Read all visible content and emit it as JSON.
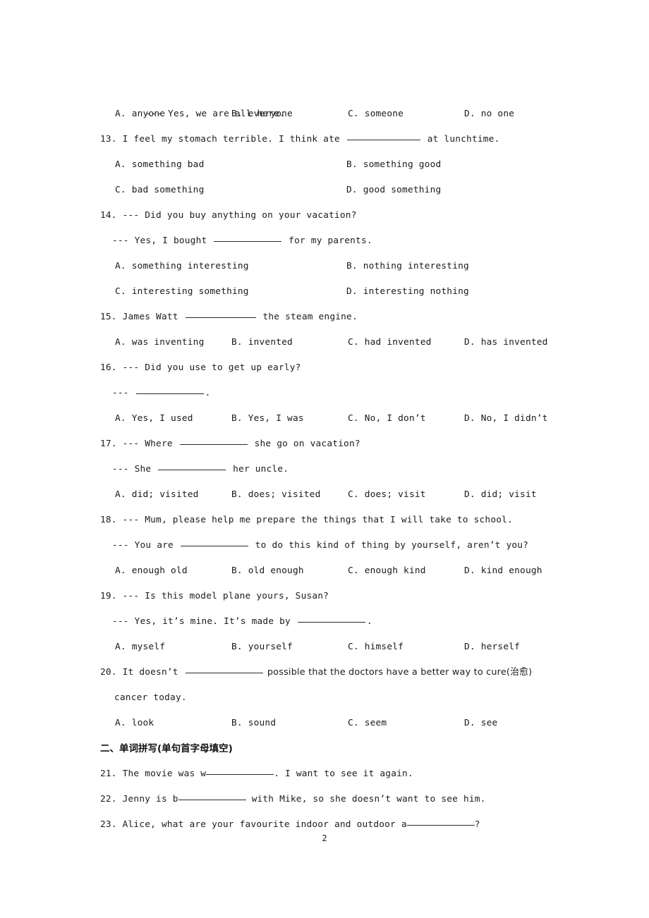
{
  "page": {
    "page_number": "2",
    "blank_mark": "______________"
  },
  "top_fragment": {
    "dialog_answer": "--- Yes, we are all here.",
    "options": [
      {
        "label": "A.",
        "text": "anyone"
      },
      {
        "label": "B.",
        "text": "everyone"
      },
      {
        "label": "C.",
        "text": "someone"
      },
      {
        "label": "D.",
        "text": "no one"
      }
    ]
  },
  "questions": [
    {
      "number": "13.",
      "stem_before": "I feel my stomach terrible. I think ate ",
      "stem_after": " at lunchtime.",
      "layout": "two-column",
      "options": [
        {
          "label": "A.",
          "text": "something bad"
        },
        {
          "label": "B.",
          "text": "something good"
        },
        {
          "label": "C.",
          "text": "bad something"
        },
        {
          "label": "D.",
          "text": "good something"
        }
      ]
    },
    {
      "number": "14.",
      "stem": "--- Did you buy anything on your vacation?",
      "reply_before": "--- Yes, I bought ",
      "reply_after": " for my parents.",
      "layout": "two-column",
      "options": [
        {
          "label": "A.",
          "text": "something interesting"
        },
        {
          "label": "B.",
          "text": "nothing interesting"
        },
        {
          "label": "C.",
          "text": "interesting something"
        },
        {
          "label": "D.",
          "text": "interesting nothing"
        }
      ]
    },
    {
      "number": "15.",
      "stem_before": "James Watt ",
      "stem_after": " the steam engine.",
      "layout": "four-column",
      "options": [
        {
          "label": "A.",
          "text": "was inventing"
        },
        {
          "label": "B.",
          "text": "invented"
        },
        {
          "label": "C.",
          "text": "had invented"
        },
        {
          "label": "D.",
          "text": "has invented"
        }
      ]
    },
    {
      "number": "16.",
      "stem": "--- Did you use to get up early?",
      "reply_before": "--- ",
      "reply_after": ".",
      "layout": "four-column",
      "options": [
        {
          "label": "A.",
          "text": "Yes, I used"
        },
        {
          "label": "B.",
          "text": "Yes, I was"
        },
        {
          "label": "C.",
          "text": "No, I don’t"
        },
        {
          "label": "D.",
          "text": "No, I didn’t"
        }
      ]
    },
    {
      "number": "17.",
      "stem_before": "--- Where ",
      "stem_after": " she go on vacation?",
      "reply_before": "--- She ",
      "reply_after": " her uncle.",
      "layout": "four-column",
      "options": [
        {
          "label": "A.",
          "text": "did; visited"
        },
        {
          "label": "B.",
          "text": "does; visited"
        },
        {
          "label": "C.",
          "text": "does; visit"
        },
        {
          "label": "D.",
          "text": "did; visit"
        }
      ]
    },
    {
      "number": "18.",
      "stem": "--- Mum, please help me prepare the things that I will take to school.",
      "reply_before": "--- You are ",
      "reply_after": " to do this kind of thing by yourself, aren’t you?",
      "layout": "four-column",
      "options": [
        {
          "label": "A.",
          "text": "enough old"
        },
        {
          "label": "B.",
          "text": "old enough"
        },
        {
          "label": "C.",
          "text": "enough kind"
        },
        {
          "label": "D.",
          "text": "kind enough"
        }
      ]
    },
    {
      "number": "19.",
      "stem": "--- Is this model plane yours, Susan?",
      "reply_before": "--- Yes, it’s mine. It’s made by ",
      "reply_after": ".",
      "layout": "four-column",
      "options": [
        {
          "label": "A.",
          "text": "myself"
        },
        {
          "label": "B.",
          "text": "yourself"
        },
        {
          "label": "C.",
          "text": "himself"
        },
        {
          "label": "D.",
          "text": "herself"
        }
      ]
    },
    {
      "number": "20.",
      "stem_before": "It doesn’t ",
      "stem_after": " possible that the doctors have a better way to cure(治愈)",
      "stem_line2": "cancer today.",
      "layout": "four-column",
      "options": [
        {
          "label": "A.",
          "text": "look"
        },
        {
          "label": "B.",
          "text": "sound"
        },
        {
          "label": "C.",
          "text": "seem"
        },
        {
          "label": "D.",
          "text": "see"
        }
      ]
    }
  ],
  "section_two": {
    "heading": "二、单词拼写(单句首字母填空)",
    "items": [
      {
        "number": "21.",
        "before": "The movie was w",
        "after": ". I want to see it again."
      },
      {
        "number": "22.",
        "before": "Jenny is b",
        "after": " with Mike, so she doesn’t want to see him."
      },
      {
        "number": "23.",
        "before": "Alice, what are your favourite indoor and outdoor a",
        "after": "?"
      }
    ]
  }
}
